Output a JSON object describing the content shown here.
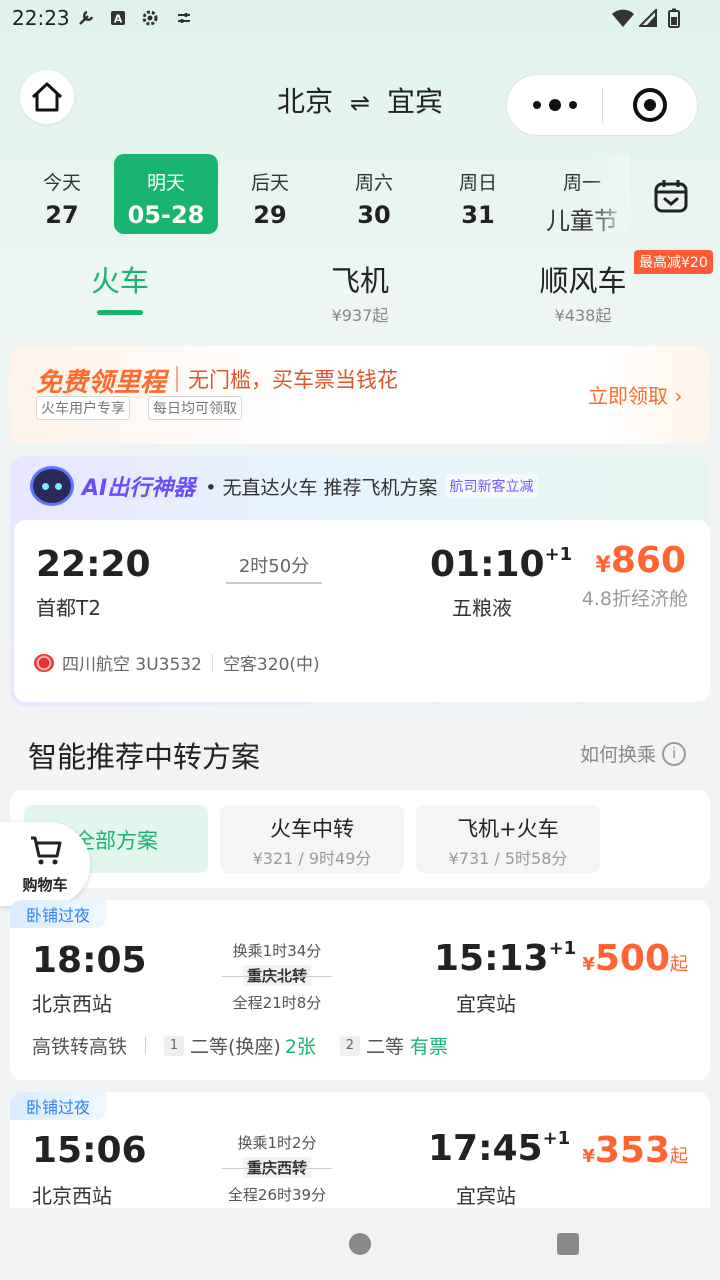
{
  "status": {
    "time": "22:23",
    "icons": [
      "wrench-icon",
      "a-icon",
      "gear-icon",
      "sliders-icon"
    ],
    "right_icons": [
      "wifi-icon",
      "signal-icon",
      "battery-icon"
    ]
  },
  "header": {
    "from": "北京",
    "swap": "⇌",
    "to": "宜宾"
  },
  "dates": [
    {
      "w": "今天",
      "d": "27"
    },
    {
      "w": "明天",
      "d": "05-28"
    },
    {
      "w": "后天",
      "d": "29"
    },
    {
      "w": "周六",
      "d": "30"
    },
    {
      "w": "周日",
      "d": "31"
    },
    {
      "w": "周一",
      "d": "儿童节"
    }
  ],
  "modes": [
    {
      "label": "火车",
      "sub": ""
    },
    {
      "label": "飞机",
      "sub": "¥937起"
    },
    {
      "label": "顺风车",
      "sub": "¥438起"
    }
  ],
  "promo_tag": "最高减¥20",
  "mileage": {
    "title": "免费领里程",
    "desc": "无门槛，买车票当钱花",
    "tags": [
      "火车用户专享",
      "每日均可领取"
    ],
    "cta": "立即领取 ›"
  },
  "ai": {
    "title": "AI出行神器",
    "desc": "• 无直达火车 推荐飞机方案",
    "badge": "航司新客立减"
  },
  "flight": {
    "dep_time": "22:20",
    "dep_station": "首都T2",
    "duration": "2时50分",
    "arr_time": "01:10",
    "arr_plus": "+1",
    "arr_station": "五粮液",
    "price_yen": "¥",
    "price": "860",
    "discount": "4.8折经济舱",
    "airline": "四川航空 3U3532",
    "aircraft": "空客320(中)"
  },
  "transfer": {
    "title": "智能推荐中转方案",
    "howto": "如何换乘",
    "info_icon": "i"
  },
  "tabs": [
    {
      "label": "全部方案",
      "sub": ""
    },
    {
      "label": "火车中转",
      "sub": "¥321 / 9时49分"
    },
    {
      "label": "飞机+火车",
      "sub": "¥731 / 5时58分"
    }
  ],
  "cart": {
    "label": "购物车"
  },
  "trains": [
    {
      "ribbon": "卧铺过夜",
      "dep_time": "18:05",
      "dep_station": "北京西站",
      "transfer_wait": "换乘1时34分",
      "transfer_station": "重庆北转",
      "total": "全程21时8分",
      "arr_time": "15:13",
      "arr_plus": "+1",
      "arr_station": "宜宾站",
      "price_yen": "¥",
      "price": "500",
      "qi": "起",
      "kind": "高铁转高铁",
      "seg1_no": "1",
      "seg1_seat": "二等(换座)",
      "seg1_avail": "2张",
      "seg2_no": "2",
      "seg2_seat": "二等",
      "seg2_avail": "有票"
    },
    {
      "ribbon": "卧铺过夜",
      "dep_time": "15:06",
      "dep_station": "北京西站",
      "transfer_wait": "换乘1时2分",
      "transfer_station": "重庆西转",
      "total": "全程26时39分",
      "arr_time": "17:45",
      "arr_plus": "+1",
      "arr_station": "宜宾站",
      "price_yen": "¥",
      "price": "353",
      "qi": "起"
    }
  ],
  "colors": {
    "accent": "#19b570",
    "price": "#ff6431",
    "ribbon": "#2b86e6",
    "promo": "#ff5a35"
  }
}
